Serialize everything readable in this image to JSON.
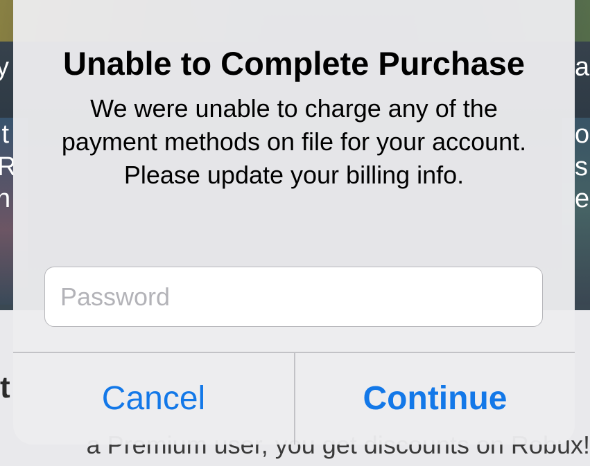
{
  "background": {
    "fragments": {
      "left_1": "y",
      "left_2": "ıt",
      "left_3": "R",
      "left_4": "n",
      "right_1": "ar",
      "right_2": "o",
      "right_3": "s.",
      "right_4": "e",
      "heading_fragment": "t",
      "subtext": "a Premium user, you get discounts on Robux!"
    }
  },
  "alert": {
    "title": "Unable to Complete Purchase",
    "message": "We were unable to charge any of the payment methods on file for your account. Please update your billing info.",
    "password_placeholder": "Password",
    "password_value": "",
    "buttons": {
      "cancel": "Cancel",
      "continue": "Continue"
    }
  },
  "colors": {
    "accent": "#1378e8",
    "alert_background": "#ececee",
    "divider": "#c2c2c6"
  }
}
